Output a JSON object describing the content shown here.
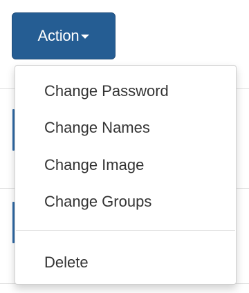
{
  "action_button": {
    "label": "Action"
  },
  "dropdown": {
    "items": [
      {
        "label": "Change Password"
      },
      {
        "label": "Change Names"
      },
      {
        "label": "Change Image"
      },
      {
        "label": "Change Groups"
      },
      {
        "label": "Delete"
      }
    ]
  },
  "colors": {
    "button_bg": "#255d93",
    "button_text": "#ffffff",
    "menu_text": "#333333",
    "menu_border": "#d0d0d0"
  }
}
